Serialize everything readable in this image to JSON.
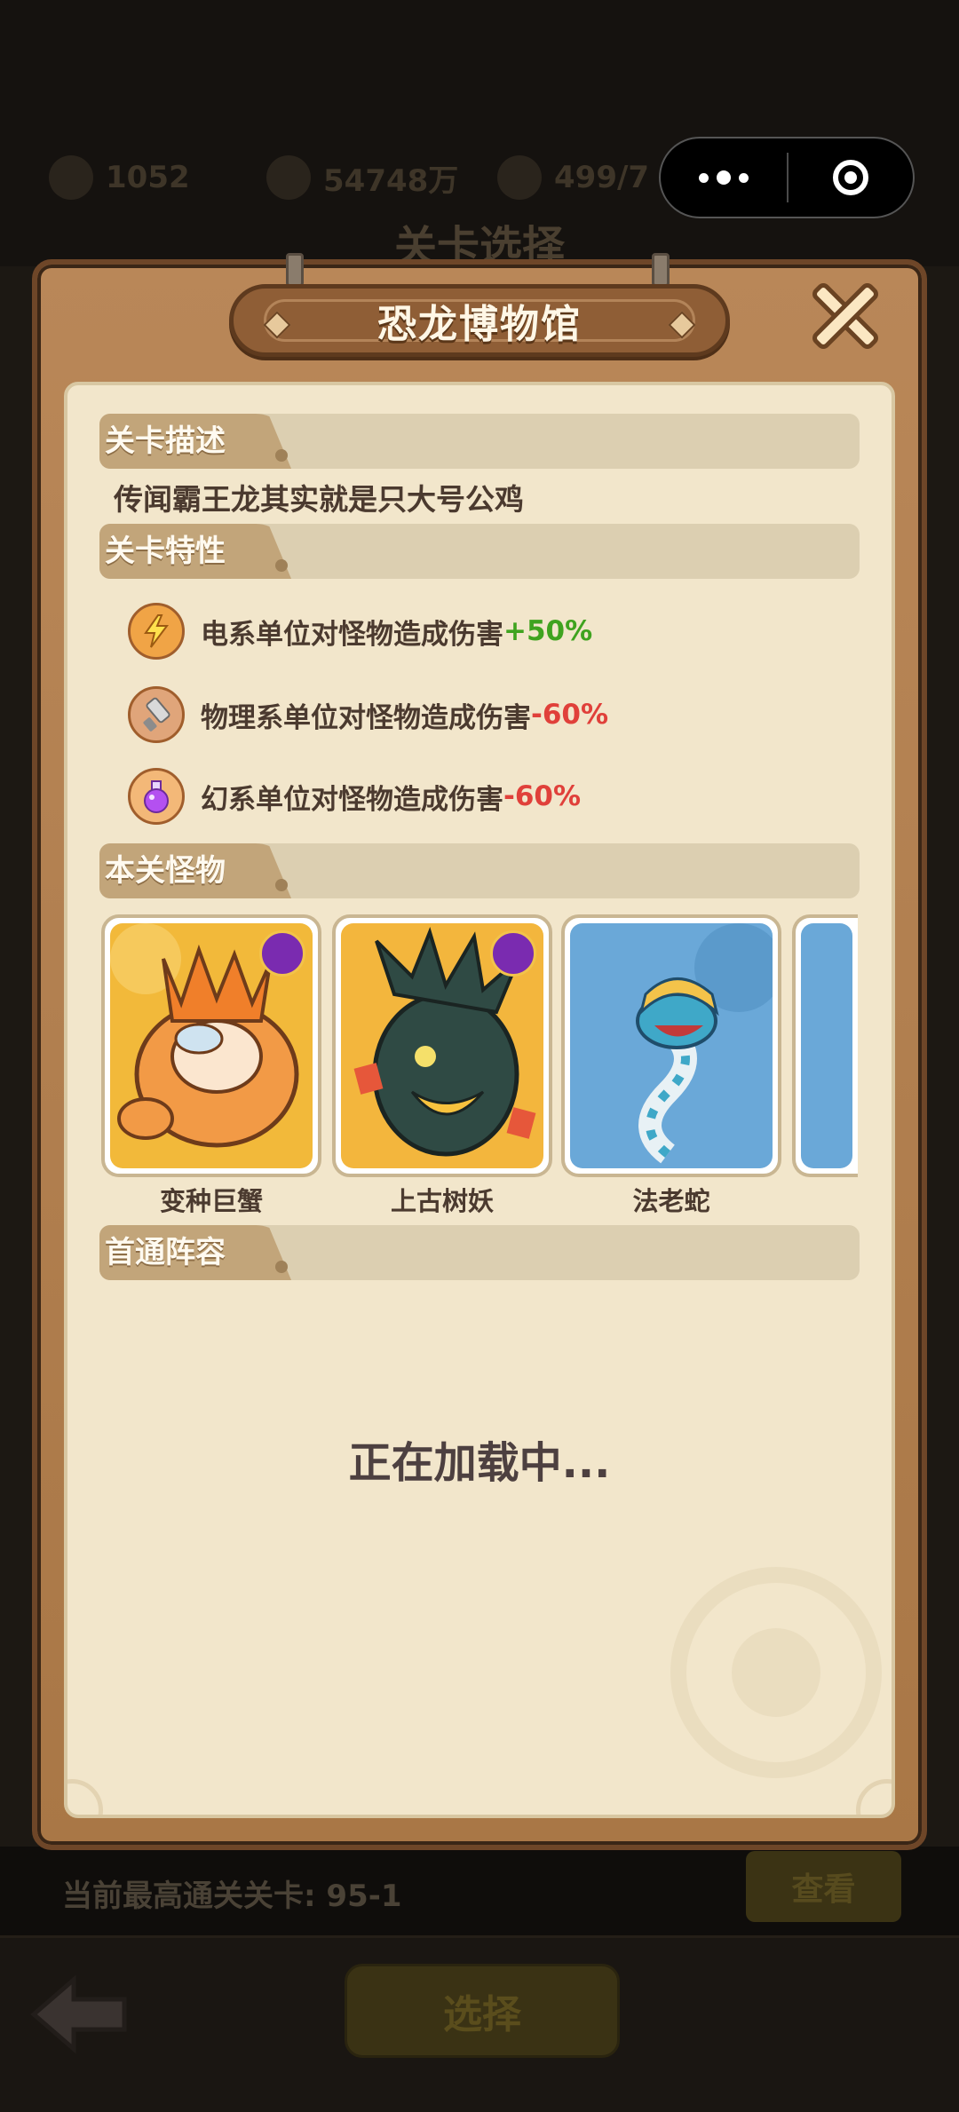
{
  "background": {
    "resources": [
      "1052",
      "54748万",
      "499/7"
    ],
    "screen_title": "关卡选择",
    "record_text": "当前最高通关关卡: 95-1",
    "view_button": "查看",
    "select_button": "选择"
  },
  "capsule": {
    "more_icon": "more-dots-icon",
    "close_icon": "target-circle-icon"
  },
  "dialog": {
    "title": "恐龙博物馆",
    "sections": {
      "description_title": "关卡描述",
      "description_text": "传闻霸王龙其实就是只大号公鸡",
      "features_title": "关卡特性",
      "monsters_title": "本关怪物",
      "first_clear_title": "首通阵容"
    },
    "features": [
      {
        "icon": "lightning-icon",
        "text": "电系单位对怪物造成伤害",
        "value": "+50%",
        "color": "#3fa31f"
      },
      {
        "icon": "sword-icon",
        "text": "物理系单位对怪物造成伤害",
        "value": "-60%",
        "color": "#e0403a"
      },
      {
        "icon": "potion-icon",
        "text": "幻系单位对怪物造成伤害",
        "value": "-60%",
        "color": "#e0403a"
      }
    ],
    "monsters": [
      {
        "name": "变种巨蟹"
      },
      {
        "name": "上古树妖"
      },
      {
        "name": "法老蛇"
      }
    ],
    "loading_text": "正在加载中..."
  }
}
